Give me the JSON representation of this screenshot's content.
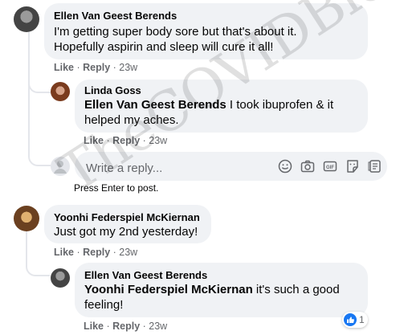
{
  "comments": [
    {
      "author": "Ellen Van Geest Berends",
      "line1": "I'm getting super body sore but that's about it.",
      "line2": "Hopefully aspirin and sleep will cure it all!",
      "like": "Like",
      "reply": "Reply",
      "time": "23w",
      "replies": [
        {
          "author": "Linda Goss",
          "mention": "Ellen Van Geest Berends",
          "text_after": " I took ibuprofen & it",
          "line2": "helped my aches.",
          "like": "Like",
          "reply": "Reply",
          "time": "23w"
        }
      ]
    },
    {
      "author": "Yoonhi Federspiel McKiernan",
      "line1": "Just got my 2nd yesterday!",
      "like": "Like",
      "reply": "Reply",
      "time": "23w",
      "replies": [
        {
          "author": "Ellen Van Geest Berends",
          "mention": "Yoonhi Federspiel McKiernan",
          "text_after": " it's such a good",
          "line2": "feeling!",
          "like": "Like",
          "reply": "Reply",
          "time": "23w",
          "reaction_count": "1"
        }
      ]
    }
  ],
  "reply_box": {
    "placeholder": "Write a reply...",
    "hint": "Press Enter to post.",
    "icons": [
      "emoji-icon",
      "camera-icon",
      "gif-icon",
      "sticker-icon",
      "avatar-sticker-icon"
    ]
  },
  "watermark": "TheCOVIDBlog.com",
  "colors": {
    "bubble": "#f0f2f5",
    "meta": "#65676b",
    "like_blue": "#1877f2"
  }
}
